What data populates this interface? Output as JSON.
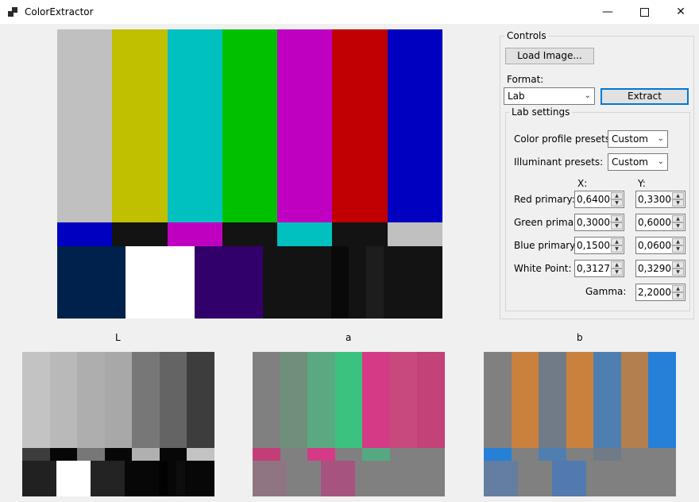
{
  "window": {
    "title": "ColorExtractor",
    "minimize_icon": "minimize-icon",
    "maximize_icon": "maximize-icon",
    "close_icon": "close-icon"
  },
  "source_image": {
    "top_colors": [
      "#c0c0c0",
      "#c0c000",
      "#00c0c0",
      "#00c000",
      "#c000c0",
      "#c00000",
      "#0000c0"
    ],
    "middle_colors": [
      "#0000c0",
      "#131313",
      "#c000c0",
      "#131313",
      "#00c0c0",
      "#131313",
      "#c0c0c0"
    ],
    "bottom_colors": [
      "#00214c",
      "#ffffff",
      "#32006a",
      "#131313",
      "#090909",
      "#131313",
      "#1d1d1d",
      "#131313"
    ]
  },
  "controls": {
    "group_title": "Controls",
    "load_button": "Load Image...",
    "format_label": "Format:",
    "format_value": "Lab",
    "extract_button": "Extract",
    "lab_group_title": "Lab settings",
    "color_profile_label": "Color profile presets:",
    "color_profile_value": "Custom",
    "illuminant_label": "Illuminant presets:",
    "illuminant_value": "Custom",
    "x_header": "X:",
    "y_header": "Y:",
    "rows": [
      {
        "label": "Red primary:",
        "x": "0,64000",
        "y": "0,33000"
      },
      {
        "label": "Green primary:",
        "x": "0,30000",
        "y": "0,60000"
      },
      {
        "label": "Blue primary:",
        "x": "0,15000",
        "y": "0,06000"
      },
      {
        "label": "White Point:",
        "x": "0,31272",
        "y": "0,32903"
      }
    ],
    "gamma_label": "Gamma:",
    "gamma_value": "2,20000"
  },
  "channels": [
    {
      "label": "L",
      "top": [
        "#c3c3c3",
        "#b9b9b9",
        "#aeaeae",
        "#a8a8a8",
        "#777777",
        "#646464",
        "#3d3d3d"
      ],
      "mid": [
        "#3d3d3d",
        "#070707",
        "#777777",
        "#070707",
        "#b0b0b0",
        "#070707",
        "#c3c3c3"
      ],
      "bottom": [
        "#212121",
        "#ffffff",
        "#232323",
        "#070707",
        "#020202",
        "#070707",
        "#0d0d0d",
        "#070707"
      ]
    },
    {
      "label": "a",
      "top": [
        "#808080",
        "#6f8f7b",
        "#5aa982",
        "#3ac27e",
        "#d53a86",
        "#c84a7d",
        "#c34278"
      ],
      "mid": [
        "#c43d79",
        "#808080",
        "#d53a86",
        "#808080",
        "#55a982",
        "#808080",
        "#808080"
      ],
      "bottom": [
        "#8e7581",
        "#808080",
        "#a65380",
        "#808080",
        "#808080",
        "#808080",
        "#808080",
        "#808080"
      ]
    },
    {
      "label": "b",
      "top": [
        "#808080",
        "#c9813d",
        "#717b87",
        "#c9813d",
        "#4e7fb0",
        "#b37f4e",
        "#2680d7"
      ],
      "mid": [
        "#2680d7",
        "#808080",
        "#4e7fb0",
        "#808080",
        "#717b87",
        "#808080",
        "#808080"
      ],
      "bottom": [
        "#637ea1",
        "#808080",
        "#5279b0",
        "#808080",
        "#808080",
        "#808080",
        "#808080",
        "#808080"
      ]
    }
  ]
}
